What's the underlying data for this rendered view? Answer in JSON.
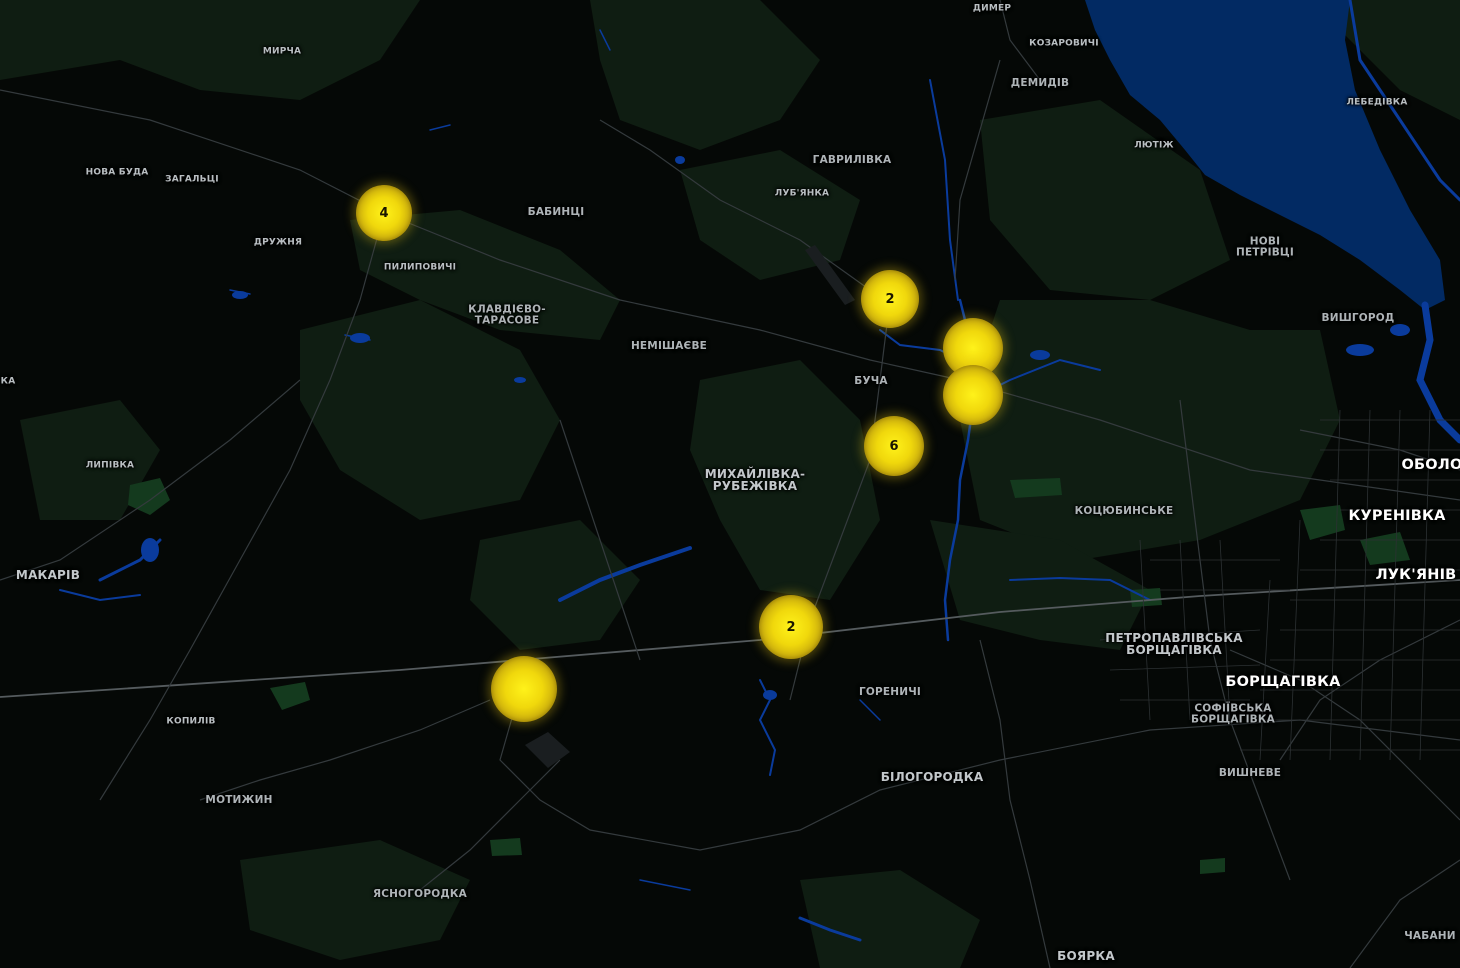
{
  "map": {
    "colors": {
      "land": "#050806",
      "forest": "#102014",
      "water": "#0a3a9a",
      "lake": "#02285e",
      "road": "#3a3f42",
      "label": "#b9bfc2",
      "cluster": "#f0d80c"
    },
    "places": [
      {
        "name": "ДИМЕР",
        "size": "xs"
      },
      {
        "name": "КОЗАРОВИЧІ",
        "size": "xs"
      },
      {
        "name": "ДЕМИДІВ",
        "size": "s"
      },
      {
        "name": "МИРЧА",
        "size": "xs"
      },
      {
        "name": "ЛЕБЕДІВКА",
        "size": "xs"
      },
      {
        "name": "ЛЮТІЖ",
        "size": "xs"
      },
      {
        "name": "ГАВРИЛІВКА",
        "size": "s"
      },
      {
        "name": "НОВА БУДА",
        "size": "xs"
      },
      {
        "name": "ЗАГАЛЬЦІ",
        "size": "xs"
      },
      {
        "name": "ЛУБ'ЯНКА",
        "size": "xs"
      },
      {
        "name": "БАБИНЦІ",
        "size": "s"
      },
      {
        "name": "ДРУЖНЯ",
        "size": "xs"
      },
      {
        "name": "НОВІ\nПЕТРІВЦІ",
        "size": "s"
      },
      {
        "name": "ПИЛИПОВИЧІ",
        "size": "xs"
      },
      {
        "name": "КЛАВДІЄВО-\nТАРАСОВЕ",
        "size": "s"
      },
      {
        "name": "ВИШГОРОД",
        "size": "s"
      },
      {
        "name": "НЕМІШАЄВЕ",
        "size": "s"
      },
      {
        "name": "БУЧА",
        "size": "s"
      },
      {
        "name": "КА",
        "size": "xs"
      },
      {
        "name": "ОБОЛО",
        "size": "l"
      },
      {
        "name": "ЛИПІВКА",
        "size": "xs"
      },
      {
        "name": "МИХАЙЛІВКА-\nРУБЕЖІВКА",
        "size": "m"
      },
      {
        "name": "КОЦЮБИНСЬКЕ",
        "size": "s"
      },
      {
        "name": "КУРЕНІВКА",
        "size": "l"
      },
      {
        "name": "ЛУК'ЯНІВ",
        "size": "l"
      },
      {
        "name": "МАКАРІВ",
        "size": "m"
      },
      {
        "name": "ПЕТРОПАВЛІВСЬКА\nБОРЩАГІВКА",
        "size": "m"
      },
      {
        "name": "БОРЩАГІВКА",
        "size": "l"
      },
      {
        "name": "ГОРЕНИЧІ",
        "size": "s"
      },
      {
        "name": "СОФІЇВСЬКА\nБОРЩАГІВКА",
        "size": "s"
      },
      {
        "name": "КОПИЛІВ",
        "size": "xs"
      },
      {
        "name": "ВИШНЕВЕ",
        "size": "s"
      },
      {
        "name": "БІЛОГОРОДКА",
        "size": "m"
      },
      {
        "name": "МОТИЖИН",
        "size": "s"
      },
      {
        "name": "ЯСНОГОРОДКА",
        "size": "s"
      },
      {
        "name": "ЧАБАНИ",
        "size": "s"
      },
      {
        "name": "БОЯРКА",
        "size": "m"
      }
    ],
    "clusters": [
      {
        "count": "4"
      },
      {
        "count": "2"
      },
      {
        "count": ""
      },
      {
        "count": ""
      },
      {
        "count": "6"
      },
      {
        "count": "2"
      },
      {
        "count": ""
      }
    ]
  }
}
